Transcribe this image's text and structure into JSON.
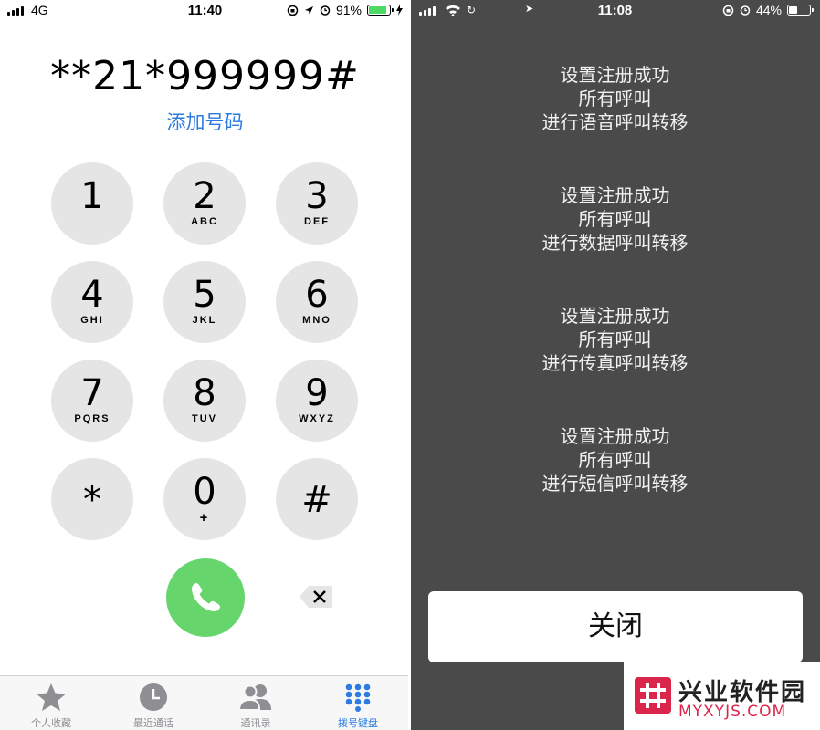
{
  "left_phone": {
    "status": {
      "carrier": "4G",
      "time": "11:40",
      "battery": "91%",
      "battery_level": 0.91
    },
    "dialed_number": "**21*999999#",
    "add_number_label": "添加号码",
    "keys": [
      {
        "digit": "1",
        "letters": ""
      },
      {
        "digit": "2",
        "letters": "ABC"
      },
      {
        "digit": "3",
        "letters": "DEF"
      },
      {
        "digit": "4",
        "letters": "GHI"
      },
      {
        "digit": "5",
        "letters": "JKL"
      },
      {
        "digit": "6",
        "letters": "MNO"
      },
      {
        "digit": "7",
        "letters": "PQRS"
      },
      {
        "digit": "8",
        "letters": "TUV"
      },
      {
        "digit": "9",
        "letters": "WXYZ"
      },
      {
        "digit": "*",
        "letters": ""
      },
      {
        "digit": "0",
        "letters": "+"
      },
      {
        "digit": "#",
        "letters": ""
      }
    ],
    "call_icon": "phone-icon",
    "delete_icon": "backspace-icon",
    "tabs": [
      {
        "label": "个人收藏",
        "icon": "star-icon"
      },
      {
        "label": "最近通话",
        "icon": "clock-icon"
      },
      {
        "label": "通讯录",
        "icon": "contacts-icon"
      },
      {
        "label": "拨号键盘",
        "icon": "keypad-icon",
        "active": true
      }
    ],
    "colors": {
      "accent": "#2b7be0",
      "call": "#65d56c",
      "key_bg": "#e5e5e5"
    }
  },
  "right_phone": {
    "status": {
      "time": "11:08",
      "battery": "44%",
      "battery_level": 0.44
    },
    "messages": [
      {
        "line1": "设置注册成功",
        "line2": "所有呼叫",
        "line3": "进行语音呼叫转移"
      },
      {
        "line1": "设置注册成功",
        "line2": "所有呼叫",
        "line3": "进行数据呼叫转移"
      },
      {
        "line1": "设置注册成功",
        "line2": "所有呼叫",
        "line3": "进行传真呼叫转移"
      },
      {
        "line1": "设置注册成功",
        "line2": "所有呼叫",
        "line3": "进行短信呼叫转移"
      }
    ],
    "close_label": "关闭",
    "colors": {
      "background": "#4a4a4a",
      "button": "#ffffff"
    }
  },
  "watermark": {
    "title": "兴业软件园",
    "subtitle": "MYXYJS.COM"
  }
}
